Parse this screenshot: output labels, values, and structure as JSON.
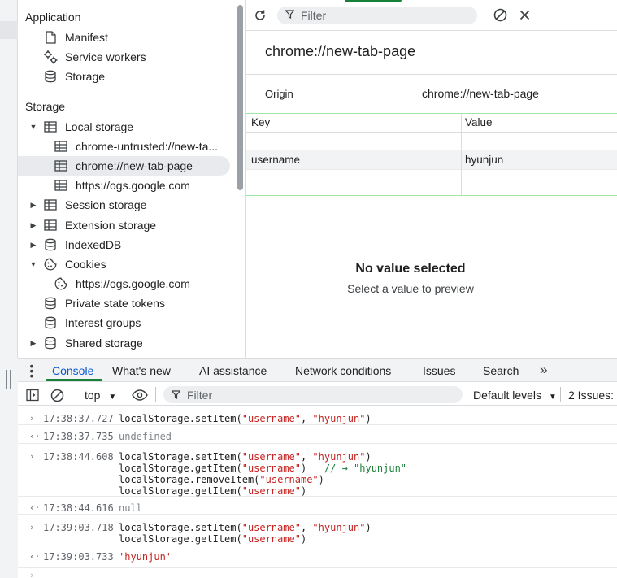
{
  "sidebar": {
    "application": {
      "title": "Application",
      "items": [
        "Manifest",
        "Service workers",
        "Storage"
      ]
    },
    "storage": {
      "title": "Storage",
      "local_storage": "Local storage",
      "local_children": [
        "chrome-untrusted://new-ta...",
        "chrome://new-tab-page",
        "https://ogs.google.com"
      ],
      "session_storage": "Session storage",
      "extension_storage": "Extension storage",
      "indexeddb": "IndexedDB",
      "cookies": "Cookies",
      "cookie_children": [
        "https://ogs.google.com"
      ],
      "private_state_tokens": "Private state tokens",
      "interest_groups": "Interest groups",
      "shared_storage": "Shared storage"
    }
  },
  "rightpane": {
    "filter_placeholder": "Filter",
    "origin_title": "chrome://new-tab-page",
    "origin_label": "Origin",
    "origin_value": "chrome://new-tab-page",
    "table": {
      "headers": [
        "Key",
        "Value"
      ],
      "rows": [
        {
          "key": "username",
          "value": "hyunjun"
        }
      ]
    },
    "empty_title": "No value selected",
    "empty_sub": "Select a value to preview"
  },
  "drawer": {
    "tabs": [
      "Console",
      "What's new",
      "AI assistance",
      "Network conditions",
      "Issues",
      "Search"
    ],
    "more": "»"
  },
  "console_toolbar": {
    "context": "top",
    "filter_placeholder": "Filter",
    "levels": "Default levels",
    "issues": "2 Issues:"
  },
  "console_log": [
    {
      "type": "input",
      "ts": "17:38:37.727"
    },
    {
      "type": "output",
      "ts": "17:38:37.735",
      "value": "undefined"
    },
    {
      "type": "input",
      "ts": "17:38:44.608"
    },
    {
      "type": "output",
      "ts": "17:38:44.616",
      "value": "null"
    },
    {
      "type": "input",
      "ts": "17:39:03.718"
    },
    {
      "type": "output",
      "ts": "17:39:03.733",
      "value": "'hyunjun'"
    }
  ],
  "code": {
    "ls_set": "localStorage.setItem(",
    "ls_get": "localStorage.getItem(",
    "ls_remove": "localStorage.removeItem(",
    "key": "\"username\"",
    "val": "\"hyunjun\"",
    "comma": ", ",
    "close": ")",
    "comment": "// → \"hyunjun\""
  },
  "colors": {
    "accent": "#0b57d0",
    "green": "#188038",
    "string": "#c5221f"
  }
}
